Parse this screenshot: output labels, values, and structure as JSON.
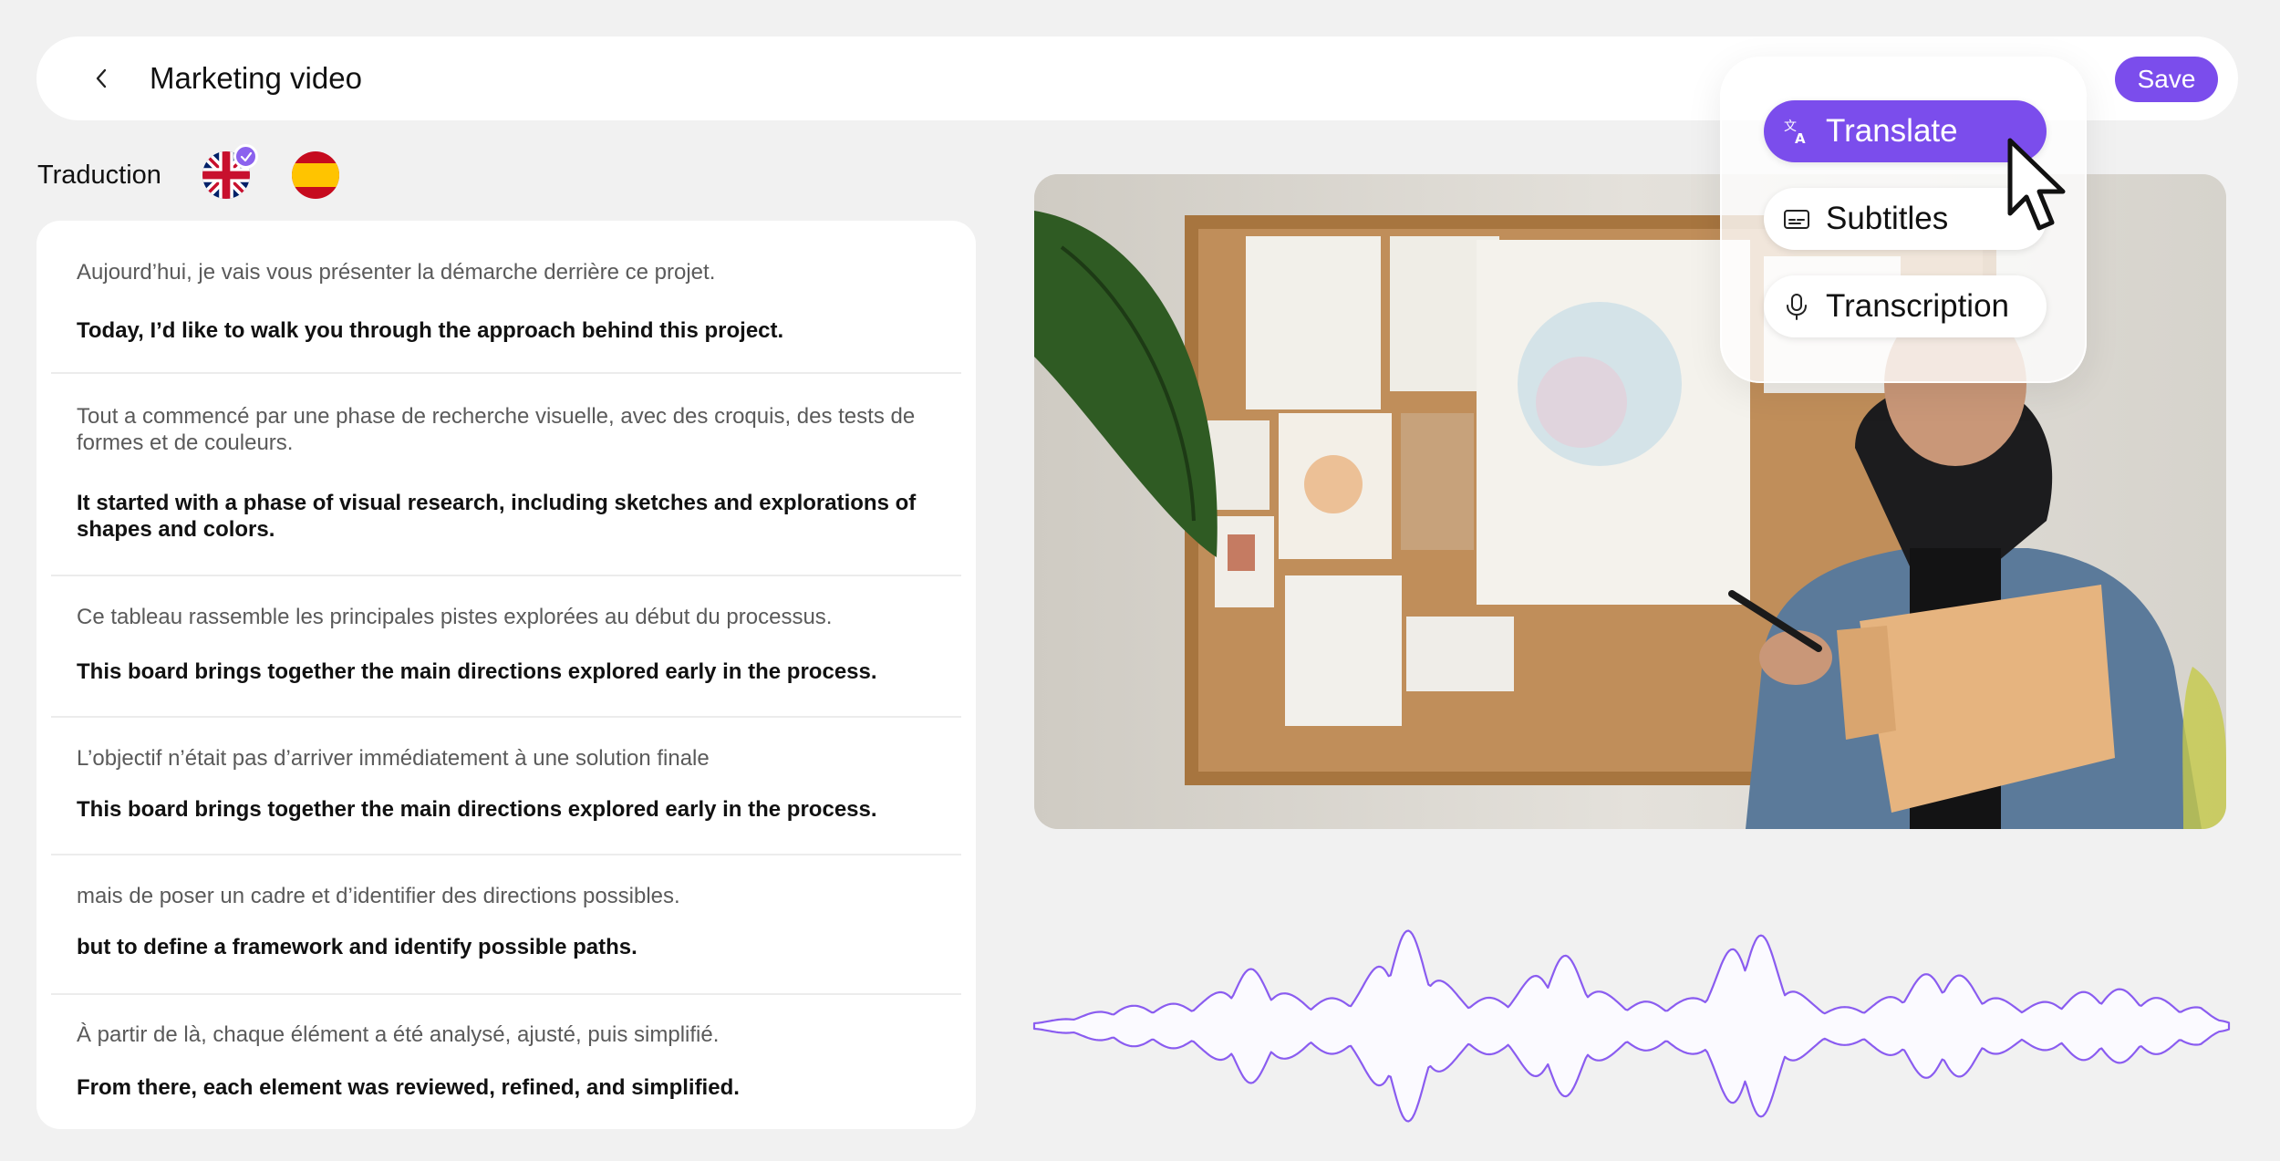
{
  "header": {
    "title": "Marketing video",
    "save_label": "Save"
  },
  "traduction": {
    "label": "Traduction",
    "languages": [
      {
        "name": "uk-flag",
        "selected": true
      },
      {
        "name": "spain-flag",
        "selected": false
      }
    ]
  },
  "segments": [
    {
      "fr": "Aujourd’hui, je vais vous présenter la démarche derrière ce projet.",
      "en": "Today, I’d like to walk you through the approach behind this project."
    },
    {
      "fr": "Tout a commencé par une phase de recherche visuelle, avec des croquis, des tests de formes et de couleurs.",
      "en": "It started with a phase of visual research, including sketches and explorations of shapes and colors."
    },
    {
      "fr": "Ce tableau rassemble les principales pistes explorées au début du processus.",
      "en": "This board brings together the main directions explored early in the process."
    },
    {
      "fr": "L’objectif n’était pas d’arriver immédiatement à une solution finale",
      "en": "This board brings together the main directions explored early in the process."
    },
    {
      "fr": "mais de poser un cadre et d’identifier des directions possibles.",
      "en": "but to define a framework and identify possible paths."
    },
    {
      "fr": "À partir de là, chaque élément a été analysé, ajusté, puis simplifié.",
      "en": "From there, each element was reviewed, refined, and simplified."
    }
  ],
  "menu": {
    "items": [
      {
        "label": "Translate",
        "icon": "translate-icon",
        "active": true
      },
      {
        "label": "Subtitles",
        "icon": "subtitles-icon",
        "active": false
      },
      {
        "label": "Transcription",
        "icon": "microphone-icon",
        "active": false
      }
    ]
  },
  "colors": {
    "accent": "#7b4dec",
    "waveform": "#8a5cf0",
    "background": "#f1f1f1"
  }
}
